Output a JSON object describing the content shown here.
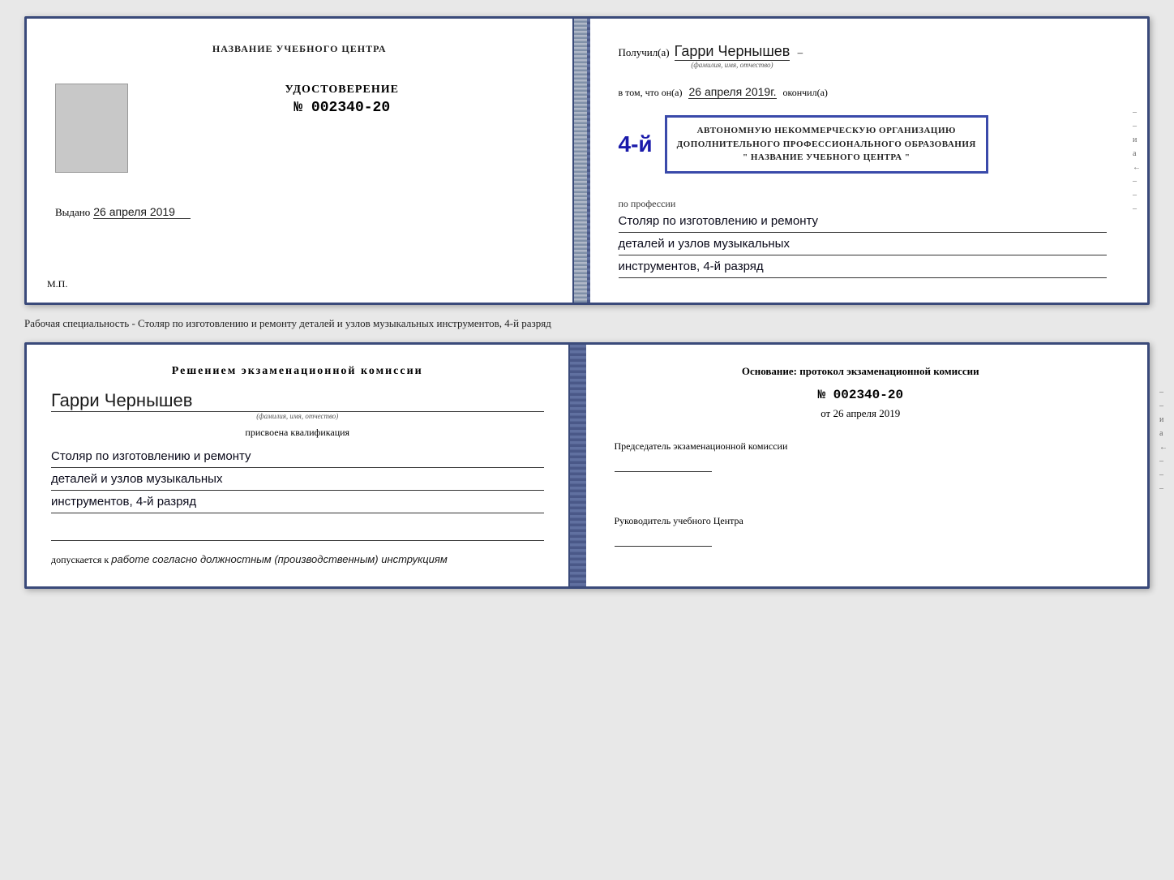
{
  "top_doc": {
    "left": {
      "org_name": "НАЗВАНИЕ УЧЕБНОГО ЦЕНТРА",
      "cert_title": "УДОСТОВЕРЕНИЕ",
      "cert_number": "№ 002340-20",
      "issued_label": "Выдано",
      "issued_date": "26 апреля 2019",
      "mp_label": "М.П."
    },
    "right": {
      "recipient_prefix": "Получил(а)",
      "recipient_name": "Гарри Чернышев",
      "recipient_subtitle": "(фамилия, имя, отчество)",
      "date_prefix": "в том, что он(а)",
      "date_value": "26 апреля 2019г.",
      "finished_label": "окончил(а)",
      "grade": "4-й",
      "stamp_line1": "АВТОНОМНУЮ НЕКОММЕРЧЕСКУЮ ОРГАНИЗАЦИЮ",
      "stamp_line2": "ДОПОЛНИТЕЛЬНОГО ПРОФЕССИОНАЛЬНОГО ОБРАЗОВАНИЯ",
      "stamp_line3": "\" НАЗВАНИЕ УЧЕБНОГО ЦЕНТРА \"",
      "profession_label": "по профессии",
      "profession_line1": "Столяр по изготовлению и ремонту",
      "profession_line2": "деталей и узлов музыкальных",
      "profession_line3": "инструментов, 4-й разряд"
    }
  },
  "separator": {
    "text": "Рабочая специальность - Столяр по изготовлению и ремонту деталей и узлов музыкальных инструментов, 4-й разряд"
  },
  "bottom_doc": {
    "left": {
      "decision_title": "Решением  экзаменационной  комиссии",
      "person_name": "Гарри Чернышев",
      "person_subtitle": "(фамилия, имя, отчество)",
      "assigned_label": "присвоена квалификация",
      "qualification_line1": "Столяр по изготовлению и ремонту",
      "qualification_line2": "деталей и узлов музыкальных",
      "qualification_line3": "инструментов, 4-й разряд",
      "allowed_prefix": "допускается к",
      "allowed_text": "работе согласно должностным (производственным) инструкциям"
    },
    "right": {
      "basis_title": "Основание: протокол экзаменационной  комиссии",
      "protocol_number": "№  002340-20",
      "date_prefix": "от",
      "date_value": "26 апреля 2019",
      "chairman_label": "Председатель экзаменационной комиссии",
      "director_label": "Руководитель учебного Центра"
    }
  },
  "side_chars": {
    "chars": [
      "и",
      "а",
      "←",
      "–",
      "–",
      "–",
      "–"
    ]
  }
}
